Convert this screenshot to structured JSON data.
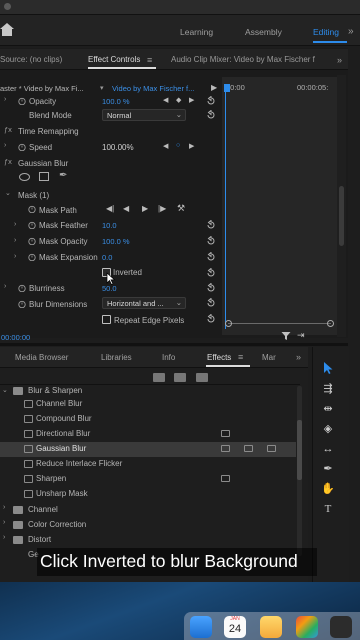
{
  "workspaces": {
    "items": [
      "Learning",
      "Assembly",
      "Editing"
    ],
    "active": "Editing"
  },
  "panel_tabs": {
    "source": "Source: (no clips)",
    "effect_controls": "Effect Controls",
    "audio_mixer": "Audio Clip Mixer: Video by Max Fischer f"
  },
  "effect_controls": {
    "master_clip": "aster * Video by Max Fi...",
    "sequence_clip": "Video by Max Fischer f...",
    "timecode_start": "00:00",
    "timecode_end": "00:00:05:",
    "opacity_label": "Opacity",
    "opacity_value": "100.0 %",
    "blend_label": "Blend Mode",
    "blend_value": "Normal",
    "time_remap_label": "Time Remapping",
    "speed_label": "Speed",
    "speed_value": "100.00%",
    "gaussian_label": "Gaussian Blur",
    "mask_label": "Mask (1)",
    "mask_path_label": "Mask Path",
    "mask_feather_label": "Mask Feather",
    "mask_feather_value": "10.0",
    "mask_opacity_label": "Mask Opacity",
    "mask_opacity_value": "100.0 %",
    "mask_expansion_label": "Mask Expansion",
    "mask_expansion_value": "0.0",
    "inverted_label": "Inverted",
    "blurriness_label": "Blurriness",
    "blurriness_value": "50.0",
    "blur_dim_label": "Blur Dimensions",
    "blur_dim_value": "Horizontal and ...",
    "repeat_edge_label": "Repeat Edge Pixels",
    "status_timecode": "00:00:00"
  },
  "effects_tabs": {
    "media_browser": "Media Browser",
    "libraries": "Libraries",
    "info": "Info",
    "effects": "Effects",
    "markers": "Mar"
  },
  "effects_list": {
    "folder_blur": "Blur & Sharpen",
    "items": [
      "Channel Blur",
      "Compound Blur",
      "Directional Blur",
      "Gaussian Blur",
      "Reduce Interlace Flicker",
      "Sharpen",
      "Unsharp Mask"
    ],
    "selected": "Gaussian Blur",
    "folders": [
      "Channel",
      "Color Correction",
      "Distort",
      "Ge"
    ]
  },
  "caption": "Click Inverted to blur Background",
  "dock": {
    "calendar_month": "JAN",
    "calendar_day": "24"
  },
  "colors": {
    "accent": "#2d8ceb",
    "background": "#1b1b1b"
  }
}
